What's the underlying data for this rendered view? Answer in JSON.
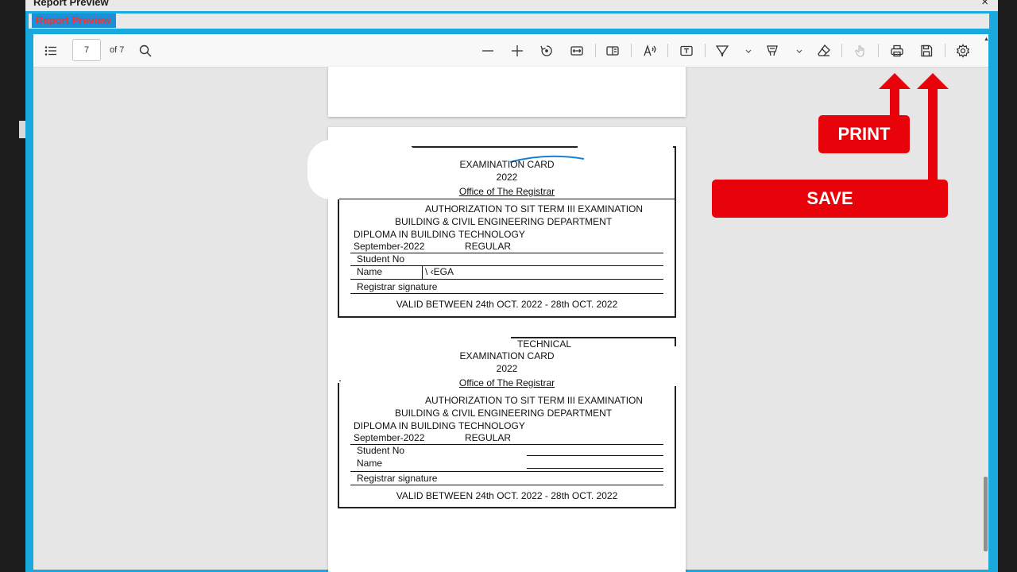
{
  "window": {
    "title": "Report Preview",
    "close_glyph": "×"
  },
  "tab": {
    "label": "Report Preview"
  },
  "toolbar": {
    "page_value": "7",
    "page_of": "of 7",
    "icons": [
      "toc-icon",
      "search-icon",
      "zoom-out-icon",
      "zoom-in-icon",
      "rotate-icon",
      "fit-width-icon",
      "page-view-icon",
      "read-aloud-icon",
      "text-box-icon",
      "draw-icon",
      "highlight-icon",
      "eraser-icon",
      "touch-icon",
      "print-icon",
      "save-icon",
      "settings-icon"
    ]
  },
  "callouts": {
    "print": "PRINT",
    "save": "SAVE",
    "color": "#e8020a"
  },
  "cards": [
    {
      "top_text": "",
      "title": "EXAMINATION CARD",
      "year": "2022",
      "office": "Office of The Registrar",
      "authorization": "AUTHORIZATION TO SIT TERM   III EXAMINATION",
      "department": "BUILDING & CIVIL ENGINEERING DEPARTMENT",
      "diploma": "DIPLOMA IN BUILDING TECHNOLOGY",
      "session": "September-2022",
      "mode": "REGULAR",
      "student_no_label": "Student No",
      "name_label": "Name",
      "name_value": "\\      ‹EGA",
      "signature_label": "Registrar signature",
      "valid": "VALID BETWEEN  24th OCT. 2022 - 28th OCT. 2022"
    },
    {
      "top_text": "TECHNICAL",
      "title": "EXAMINATION CARD",
      "year": "2022",
      "office": "Office of The Registrar",
      "authorization": "AUTHORIZATION TO SIT TERM   III EXAMINATION",
      "department": "BUILDING & CIVIL ENGINEERING DEPARTMENT",
      "diploma": "DIPLOMA IN BUILDING TECHNOLOGY",
      "session": "September-2022",
      "mode": "REGULAR",
      "student_no_label": "Student No",
      "name_label": "Name",
      "name_value": "",
      "signature_label": "Registrar signature",
      "valid": "VALID BETWEEN  24th OCT. 2022 - 28th OCT. 2022"
    }
  ]
}
